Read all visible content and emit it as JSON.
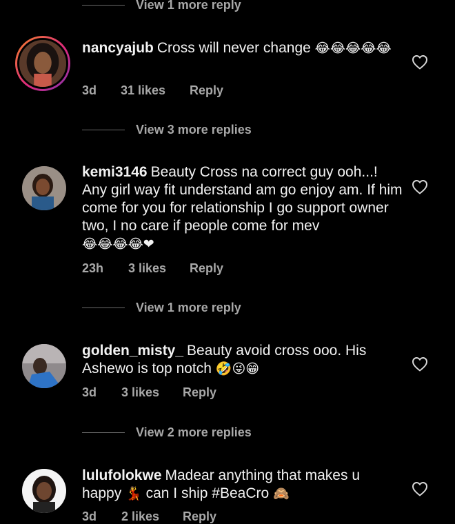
{
  "top_link": {
    "text": "View 1 more reply"
  },
  "comments": [
    {
      "username": "nancyajub",
      "text": "Cross will never change",
      "emoji": "😂😂😂😂😂",
      "time": "3d",
      "likes": "31 likes",
      "reply": "Reply",
      "more_replies": "View 3 more replies"
    },
    {
      "username": "kemi3146",
      "text": "Beauty Cross na correct guy ooh...! Any girl way fit understand am go enjoy am. If him come for you for relationship I go support owner two, I no care if people come for mev",
      "emoji": "😂😂😂😂❤",
      "time": "23h",
      "likes": "3 likes",
      "reply": "Reply",
      "more_replies": "View 1 more reply"
    },
    {
      "username": "golden_misty_",
      "text": "Beauty avoid cross ooo. His Ashewo is top notch",
      "emoji": "🤣😜😁",
      "time": "3d",
      "likes": "3 likes",
      "reply": "Reply",
      "more_replies": "View 2 more replies"
    },
    {
      "username": "lulufolokwe",
      "text": "Madear anything that makes u happy",
      "text2": "can I ship #BeaCro",
      "emoji": "💃",
      "emoji2": "🙈",
      "time": "3d",
      "likes": "2 likes",
      "reply": "Reply"
    }
  ],
  "colors": {
    "background": "#000000",
    "primary_text": "#f2f2f2",
    "secondary_text": "#a8a8a8",
    "story_ring_start": "#f58529",
    "story_ring_end": "#8134af"
  },
  "icons": {
    "like": "heart-outline-icon"
  }
}
